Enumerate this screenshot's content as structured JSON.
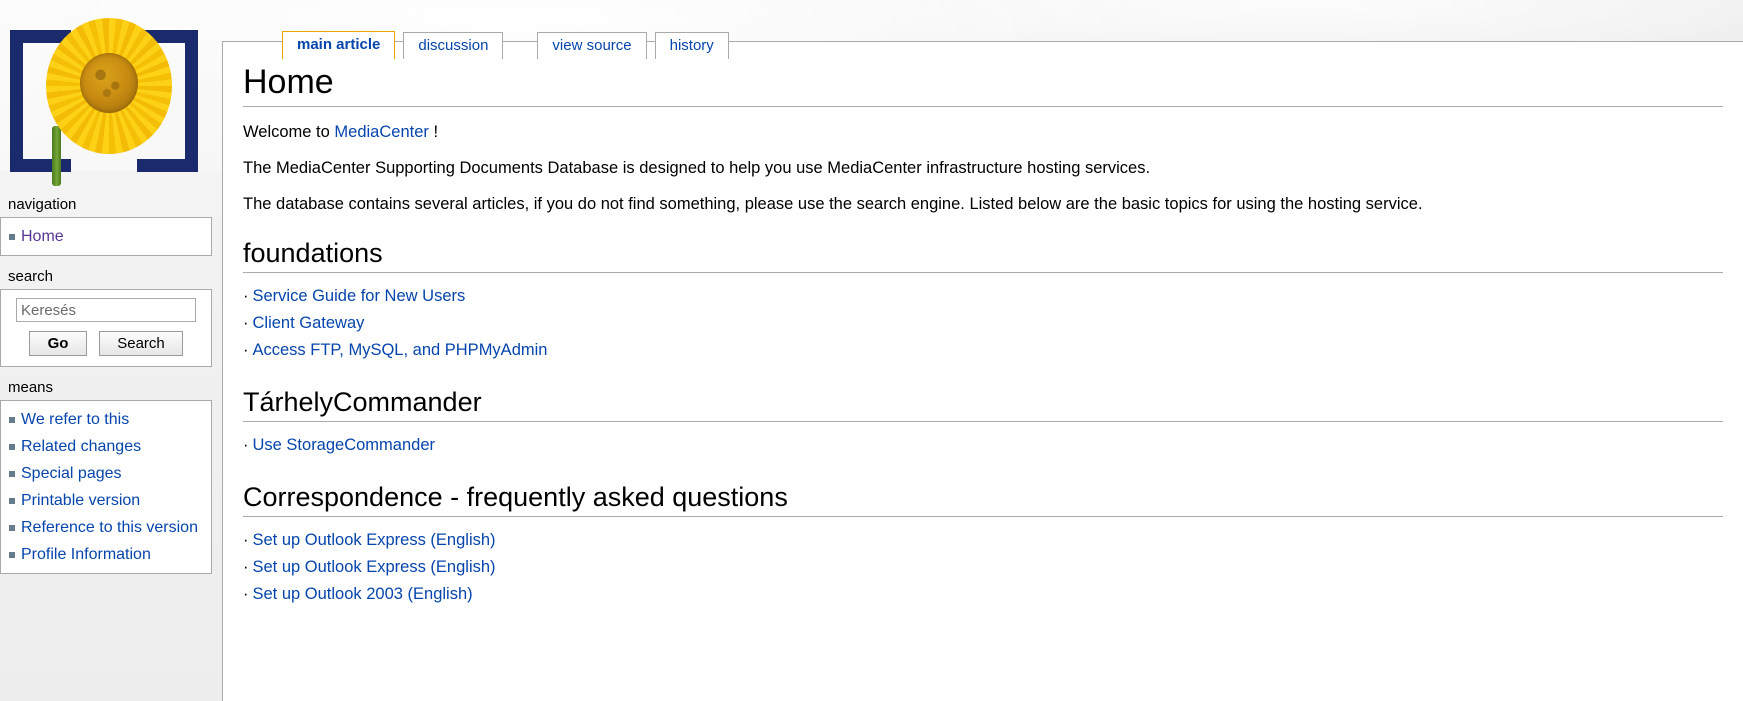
{
  "colors": {
    "link": "#0645ad",
    "visited_link": "#5a3696",
    "tab_selected_border": "#e8a400",
    "border": "#aaaaaa",
    "bullet": "#667b8c",
    "logo_bracket": "#1a2a6c",
    "petal": "#fcd116",
    "disc": "#c98c12"
  },
  "logo": {
    "name": "sunflower-brackets-logo",
    "alt": "[ sunflower ]"
  },
  "tabs": [
    {
      "id": "main-article",
      "label": "main article",
      "selected": true
    },
    {
      "id": "discussion",
      "label": "discussion",
      "selected": false
    },
    {
      "id": "view-source",
      "label": "view source",
      "selected": false
    },
    {
      "id": "history",
      "label": "history",
      "selected": false
    }
  ],
  "sidebar": {
    "navigation": {
      "heading": "navigation",
      "items": [
        {
          "label": "Home",
          "visited": true
        }
      ]
    },
    "search": {
      "heading": "search",
      "placeholder": "Keresés",
      "value": "",
      "go_label": "Go",
      "search_label": "Search"
    },
    "toolbox": {
      "heading": "means",
      "items": [
        {
          "label": "We refer to this"
        },
        {
          "label": "Related changes"
        },
        {
          "label": "Special pages"
        },
        {
          "label": "Printable version"
        },
        {
          "label": "Reference to this version"
        },
        {
          "label": "Profile Information"
        }
      ]
    }
  },
  "main": {
    "title": "Home",
    "welcome": {
      "before": "Welcome to ",
      "link": "MediaCenter",
      "after": " !"
    },
    "paragraphs": [
      "The MediaCenter Supporting Documents Database is designed to help you use MediaCenter infrastructure hosting services.",
      "The database contains several articles, if you do not find something, please use the search engine. Listed below are the basic topics for using the hosting service."
    ],
    "sections": [
      {
        "heading": "foundations",
        "links": [
          "Service Guide for New Users",
          "Client Gateway",
          "Access FTP, MySQL, and PHPMyAdmin"
        ]
      },
      {
        "heading": "TárhelyCommander",
        "links": [
          "Use StorageCommander"
        ]
      },
      {
        "heading": "Correspondence - frequently asked questions",
        "links": [
          "Set up Outlook Express (English)",
          "Set up Outlook Express (English)",
          "Set up Outlook 2003 (English)"
        ]
      }
    ],
    "bullet_glyph": "·"
  }
}
